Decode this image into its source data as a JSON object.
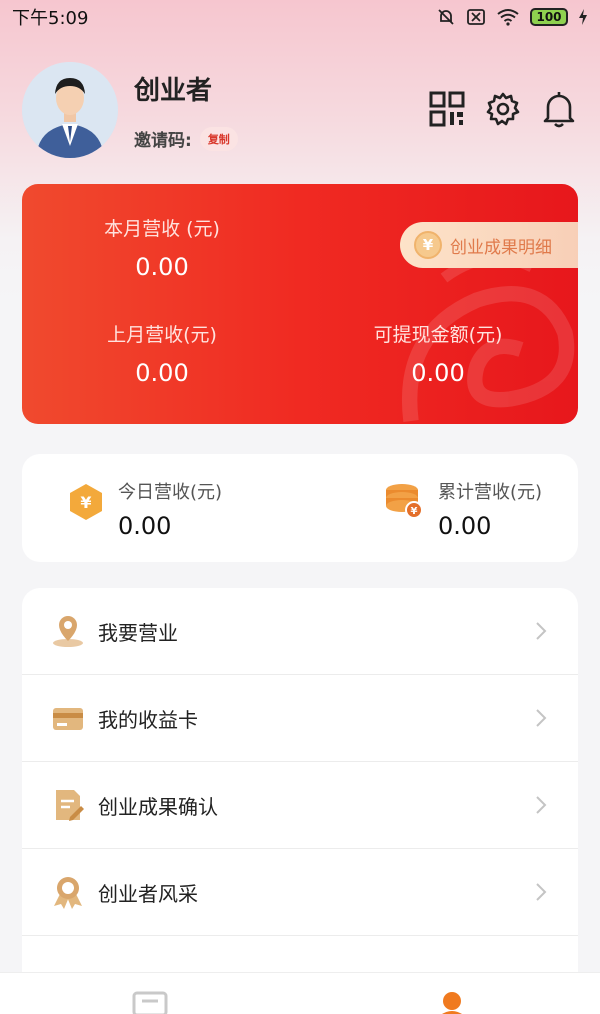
{
  "status_bar": {
    "time": "下午5:09",
    "battery": "100"
  },
  "profile": {
    "name": "创业者",
    "invite_label": "邀请码:",
    "copy_label": "复制"
  },
  "header_icons": [
    "qrcode-icon",
    "gear-icon",
    "bell-icon"
  ],
  "revenue_card": {
    "this_month_label": "本月营收 (元)",
    "this_month_value": "0.00",
    "detail_link": "创业成果明细",
    "last_month_label": "上月营收(元)",
    "last_month_value": "0.00",
    "withdrawable_label": "可提现金额(元)",
    "withdrawable_value": "0.00"
  },
  "summary": {
    "today_label": "今日营收(元)",
    "today_value": "0.00",
    "total_label": "累计营收(元)",
    "total_value": "0.00"
  },
  "menu": [
    {
      "label": "我要营业",
      "icon": "location-pin-icon"
    },
    {
      "label": "我的收益卡",
      "icon": "card-icon"
    },
    {
      "label": "创业成果确认",
      "icon": "document-edit-icon"
    },
    {
      "label": "创业者风采",
      "icon": "award-icon"
    }
  ],
  "colors": {
    "accent_red": "#ef2b23",
    "gold": "#f0a23c",
    "orange_text": "#e07a4b"
  }
}
